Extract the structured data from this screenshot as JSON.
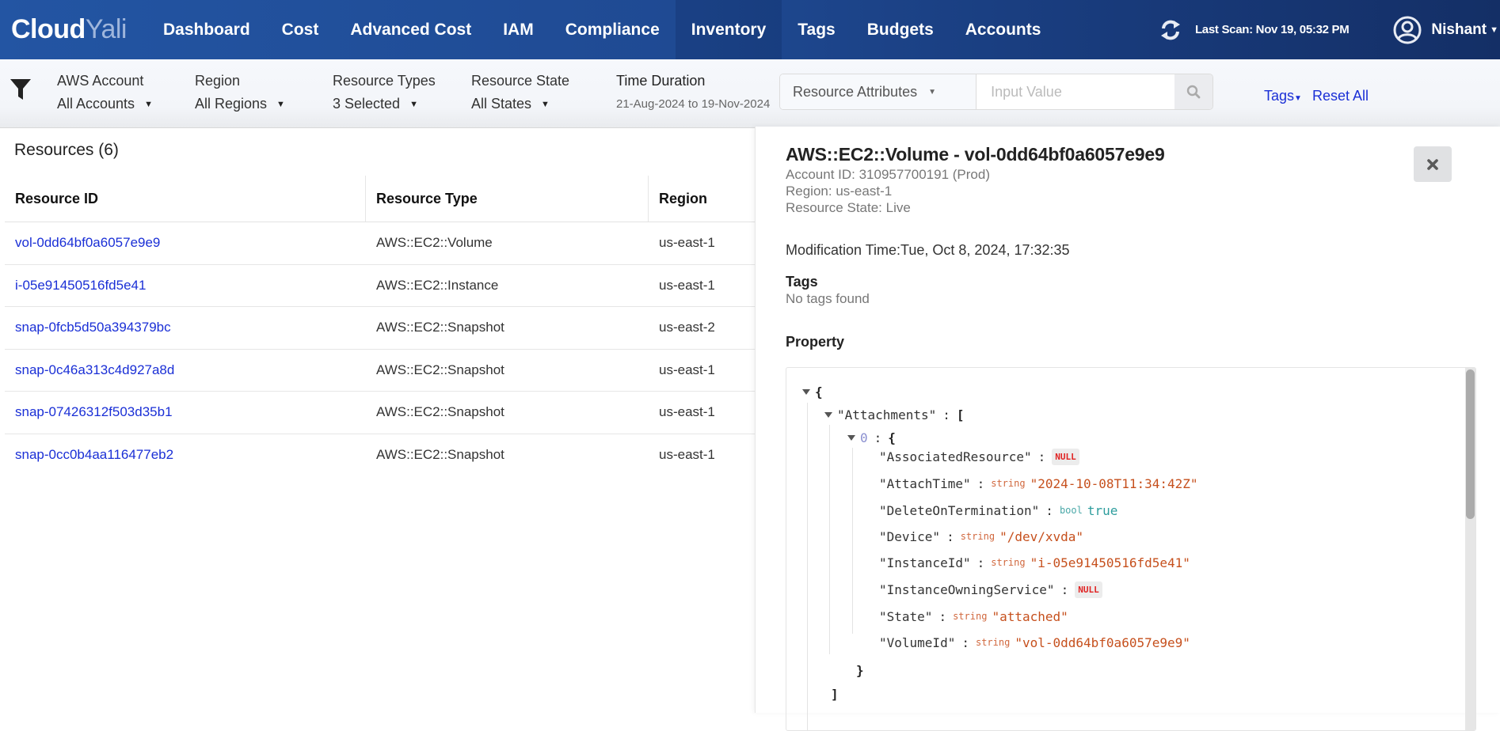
{
  "app": {
    "logo_part1": "Cloud",
    "logo_part2": "Yali"
  },
  "nav": {
    "items": [
      {
        "label": "Dashboard"
      },
      {
        "label": "Cost"
      },
      {
        "label": "Advanced Cost"
      },
      {
        "label": "IAM"
      },
      {
        "label": "Compliance"
      },
      {
        "label": "Inventory",
        "active": true
      },
      {
        "label": "Tags"
      },
      {
        "label": "Budgets"
      },
      {
        "label": "Accounts"
      }
    ],
    "last_scan": "Last Scan: Nov 19, 05:32 PM",
    "user": "Nishant",
    "icons": {
      "refresh": "refresh-icon",
      "user": "user-circle-icon",
      "caret": "caret-down-icon"
    }
  },
  "filters": {
    "aws_account": {
      "label": "AWS Account",
      "value": "All Accounts"
    },
    "region": {
      "label": "Region",
      "value": "All Regions"
    },
    "resource_types": {
      "label": "Resource Types",
      "value": "3 Selected"
    },
    "resource_state": {
      "label": "Resource State",
      "value": "All States"
    },
    "time_duration": {
      "label": "Time Duration",
      "value": "21-Aug-2024 to 19-Nov-2024"
    },
    "attribute_select": "Resource Attributes",
    "attribute_input_placeholder": "Input Value",
    "attribute_input_value": "",
    "tags_link": "Tags",
    "reset_link": "Reset All"
  },
  "resources": {
    "title": "Resources (6)",
    "columns": [
      "Resource ID",
      "Resource Type",
      "Region"
    ],
    "rows": [
      {
        "id": "vol-0dd64bf0a6057e9e9",
        "type": "AWS::EC2::Volume",
        "region": "us-east-1"
      },
      {
        "id": "i-05e91450516fd5e41",
        "type": "AWS::EC2::Instance",
        "region": "us-east-1"
      },
      {
        "id": "snap-0fcb5d50a394379bc",
        "type": "AWS::EC2::Snapshot",
        "region": "us-east-2"
      },
      {
        "id": "snap-0c46a313c4d927a8d",
        "type": "AWS::EC2::Snapshot",
        "region": "us-east-1"
      },
      {
        "id": "snap-07426312f503d35b1",
        "type": "AWS::EC2::Snapshot",
        "region": "us-east-1"
      },
      {
        "id": "snap-0cc0b4aa116477eb2",
        "type": "AWS::EC2::Snapshot",
        "region": "us-east-1"
      }
    ]
  },
  "detail": {
    "title": "AWS::EC2::Volume - vol-0dd64bf0a6057e9e9",
    "account": "Account ID: 310957700191 (Prod)",
    "region": "Region: us-east-1",
    "state": "Resource State: Live",
    "modification": "Modification Time:Tue, Oct 8, 2024, 17:32:35",
    "tags_heading": "Tags",
    "tags_value": "No tags found",
    "property_heading": "Property",
    "json": {
      "root_open": "{",
      "attachments_key": "\"Attachments\"",
      "attachments_open": "[",
      "index": "0",
      "index_open": "{",
      "fields": [
        {
          "key": "\"AssociatedResource\"",
          "type": "",
          "value": "NULL",
          "kind": "null"
        },
        {
          "key": "\"AttachTime\"",
          "type": "string",
          "value": "\"2024-10-08T11:34:42Z\"",
          "kind": "string"
        },
        {
          "key": "\"DeleteOnTermination\"",
          "type": "bool",
          "value": "true",
          "kind": "bool"
        },
        {
          "key": "\"Device\"",
          "type": "string",
          "value": "\"/dev/xvda\"",
          "kind": "string"
        },
        {
          "key": "\"InstanceId\"",
          "type": "string",
          "value": "\"i-05e91450516fd5e41\"",
          "kind": "string"
        },
        {
          "key": "\"InstanceOwningService\"",
          "type": "",
          "value": "NULL",
          "kind": "null"
        },
        {
          "key": "\"State\"",
          "type": "string",
          "value": "\"attached\"",
          "kind": "string"
        },
        {
          "key": "\"VolumeId\"",
          "type": "string",
          "value": "\"vol-0dd64bf0a6057e9e9\"",
          "kind": "string"
        }
      ],
      "index_close": "}",
      "attachments_close": "]",
      "colon": ":"
    }
  }
}
